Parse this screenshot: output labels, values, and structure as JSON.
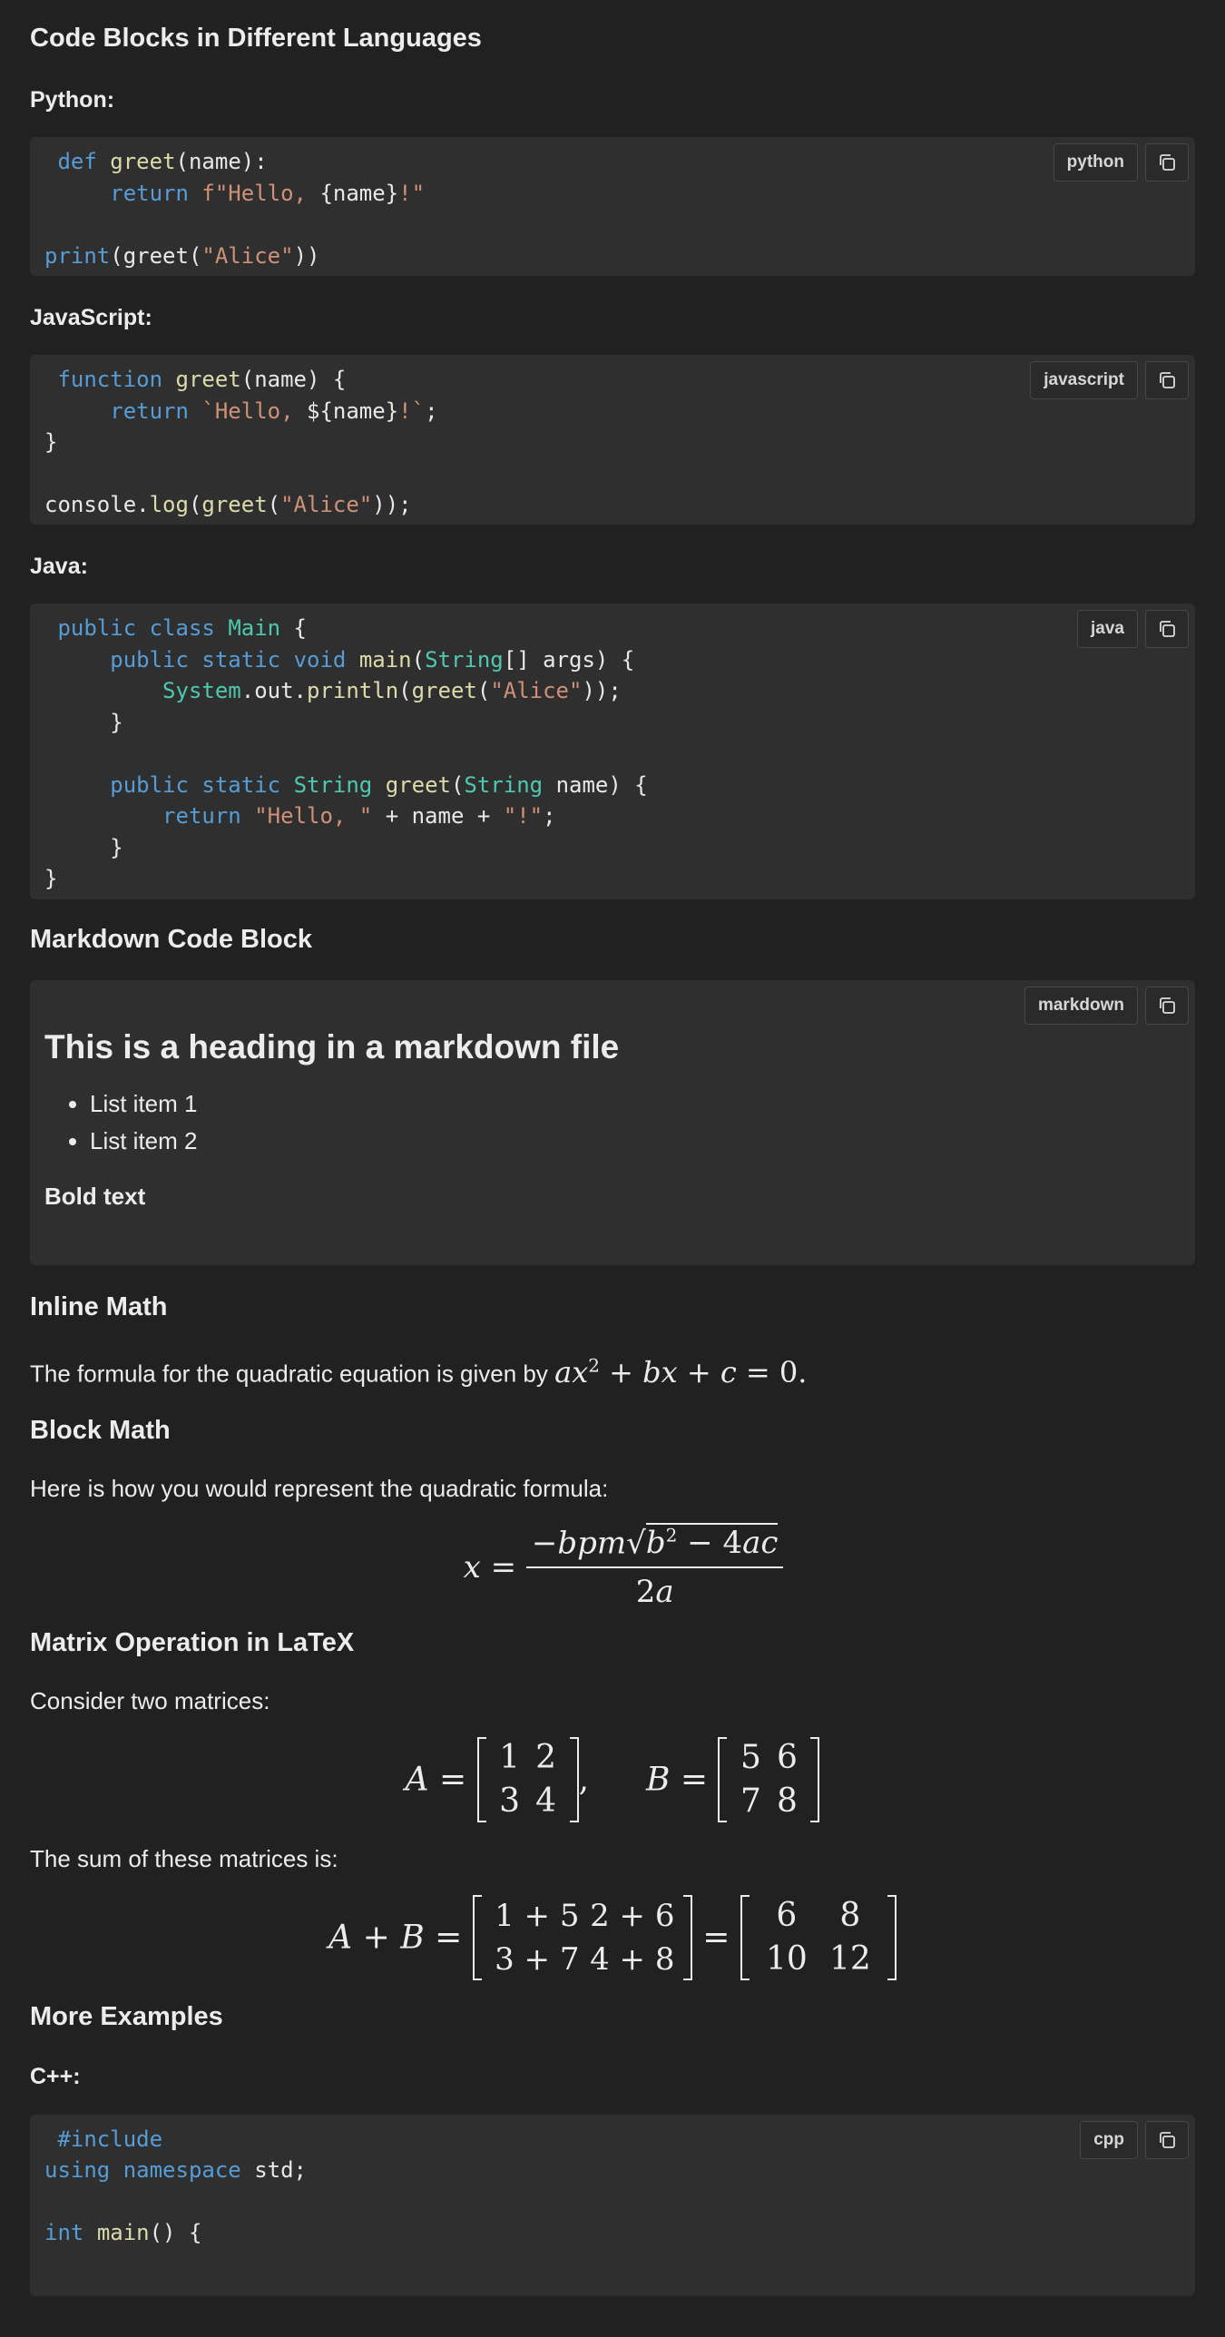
{
  "title": "Code Blocks in Different Languages",
  "sections": {
    "python_heading": "Python:",
    "javascript_heading": "JavaScript:",
    "java_heading": "Java:",
    "markdown_heading": "Markdown Code Block",
    "inline_math_heading": "Inline Math",
    "block_math_heading": "Block Math",
    "matrix_heading": "Matrix Operation in LaTeX",
    "more_examples_heading": "More Examples",
    "cpp_heading": "C++:"
  },
  "code_blocks": {
    "python": {
      "lang": "python"
    },
    "javascript": {
      "lang": "javascript"
    },
    "java": {
      "lang": "java"
    },
    "markdown": {
      "lang": "markdown"
    },
    "cpp": {
      "lang": "cpp"
    }
  },
  "markdown_block": {
    "heading": "This is a heading in a markdown file",
    "items": [
      "List item 1",
      "List item 2"
    ],
    "bold": "Bold text"
  },
  "inline_math": {
    "text": "The formula for the quadratic equation is given by "
  },
  "block_math": {
    "text": "Here is how you would represent the quadratic formula:"
  },
  "matrix": {
    "intro": "Consider two matrices:",
    "sum_text": "The sum of these matrices is:",
    "A": [
      [
        "1",
        "2"
      ],
      [
        "3",
        "4"
      ]
    ],
    "B": [
      [
        "5",
        "6"
      ],
      [
        "7",
        "8"
      ]
    ],
    "sum_expr": [
      [
        "1 + 5",
        "2 + 6"
      ],
      [
        "3 + 7",
        "4 + 8"
      ]
    ],
    "sum_result": [
      [
        "6",
        "8"
      ],
      [
        "10",
        "12"
      ]
    ]
  },
  "colors": {
    "background": "#212121",
    "code_background": "#2f2f2f",
    "keyword": "#569cd6",
    "function": "#dcdcaa",
    "string": "#ce9178",
    "type": "#4ec9b0"
  },
  "icons": {
    "copy": "copy-icon"
  }
}
